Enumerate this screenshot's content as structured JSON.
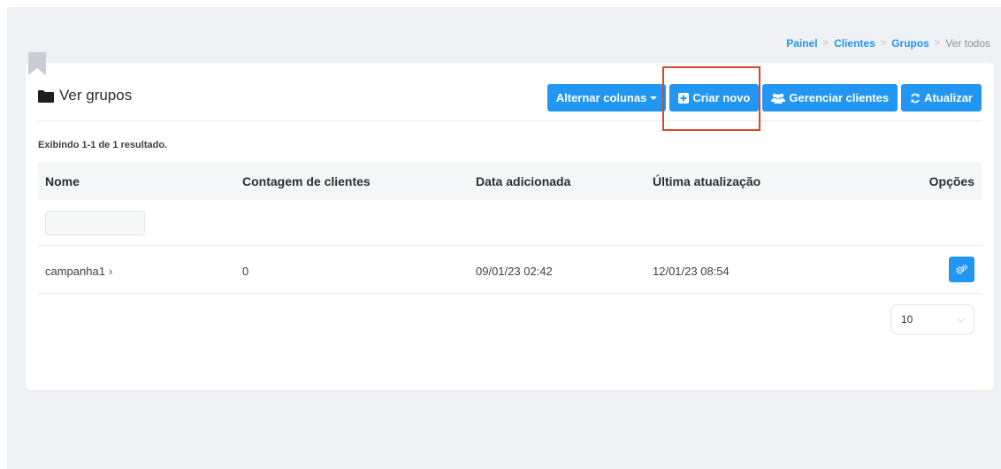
{
  "breadcrumb": {
    "items": [
      "Painel",
      "Clientes",
      "Grupos"
    ],
    "current": "Ver todos",
    "separator": ">"
  },
  "header": {
    "title": "Ver grupos",
    "icon": "folder-icon"
  },
  "toolbar": {
    "toggle_columns": "Alternar colunas",
    "create_new": "Criar novo",
    "manage_clients": "Gerenciar clientes",
    "refresh": "Atualizar"
  },
  "summary": "Exibindo 1-1 de 1 resultado.",
  "table": {
    "columns": [
      "Nome",
      "Contagem de clientes",
      "Data adicionada",
      "Última atualização",
      "Opções"
    ],
    "rows": [
      {
        "name": "campanha1",
        "client_count": "0",
        "date_added": "09/01/23 02:42",
        "last_updated": "12/01/23 08:54"
      }
    ]
  },
  "pagination": {
    "page_size": "10"
  },
  "colors": {
    "accent": "#2196f3",
    "highlight": "#d9472b"
  }
}
